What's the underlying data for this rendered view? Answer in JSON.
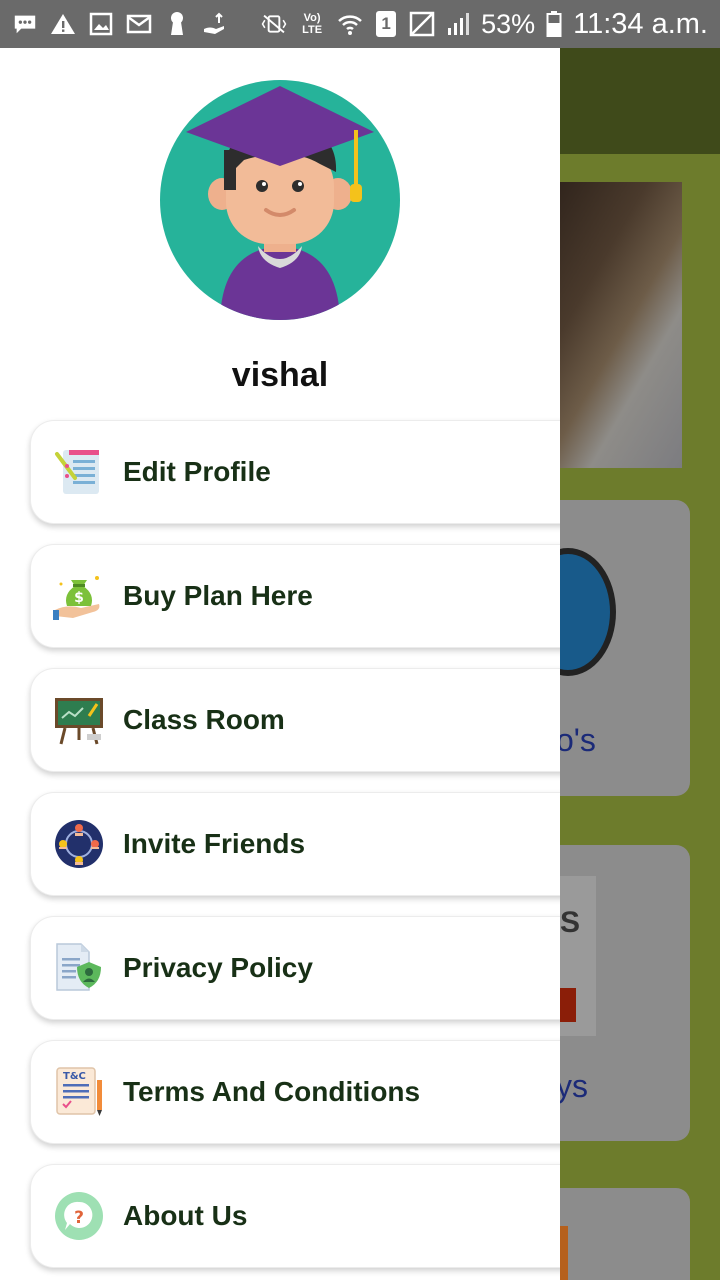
{
  "status_bar": {
    "battery_percent": "53%",
    "time": "11:34 a.m.",
    "sim_slot": "1",
    "network_label": "Vo) LTE",
    "icons": [
      "message-icon",
      "warning-icon",
      "image-icon",
      "mail-icon",
      "keyhole-icon",
      "hand-upload-icon",
      "vibrate-icon",
      "volte-icon",
      "wifi-icon",
      "sim-icon",
      "no-signal-icon",
      "signal-icon",
      "battery-icon"
    ]
  },
  "drawer": {
    "username": "vishal",
    "avatar": "graduate-avatar",
    "menu": [
      {
        "label": "Edit Profile",
        "icon": "edit-profile-icon"
      },
      {
        "label": "Buy Plan Here",
        "icon": "money-bag-icon"
      },
      {
        "label": "Class Room",
        "icon": "chalkboard-icon"
      },
      {
        "label": "Invite Friends",
        "icon": "invite-friends-icon"
      },
      {
        "label": "Privacy Policy",
        "icon": "privacy-shield-icon"
      },
      {
        "label": "Terms And Conditions",
        "icon": "terms-document-icon",
        "icon_text": "T&C"
      },
      {
        "label": "About Us",
        "icon": "help-bubble-icon",
        "icon_text": "?"
      }
    ]
  },
  "background": {
    "card_texts": [
      "o's",
      "ys"
    ],
    "book_text": "S"
  }
}
